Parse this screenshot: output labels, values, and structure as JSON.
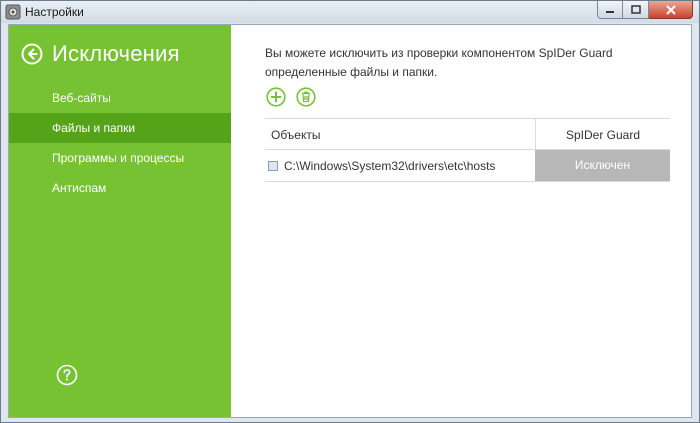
{
  "window": {
    "title": "Настройки",
    "icons": {
      "app": "gear-app-icon",
      "minimize": "minimize-icon",
      "maximize": "maximize-icon",
      "close": "close-icon"
    }
  },
  "sidebar": {
    "title": "Исключения",
    "back_icon": "arrow-left-circle-icon",
    "items": [
      {
        "label": "Веб-сайты",
        "active": false
      },
      {
        "label": "Файлы и папки",
        "active": true
      },
      {
        "label": "Программы и процессы",
        "active": false
      },
      {
        "label": "Антиспам",
        "active": false
      }
    ],
    "help_icon": "question-circle-icon"
  },
  "main": {
    "description": "Вы можете исключить из проверки компонентом SpIDer Guard определенные файлы и папки.",
    "toolbar": {
      "add_icon": "plus-circle-icon",
      "delete_icon": "trash-circle-icon"
    },
    "table": {
      "columns": [
        "Объекты",
        "SpIDer Guard"
      ],
      "rows": [
        {
          "path": "C:\\Windows\\System32\\drivers\\etc\\hosts",
          "status": "Исключен"
        }
      ]
    }
  },
  "colors": {
    "sidebar": "#76c232",
    "sidebar_active": "#55a318",
    "accent": "#76c232",
    "status_cell": "#b7b7b7"
  }
}
